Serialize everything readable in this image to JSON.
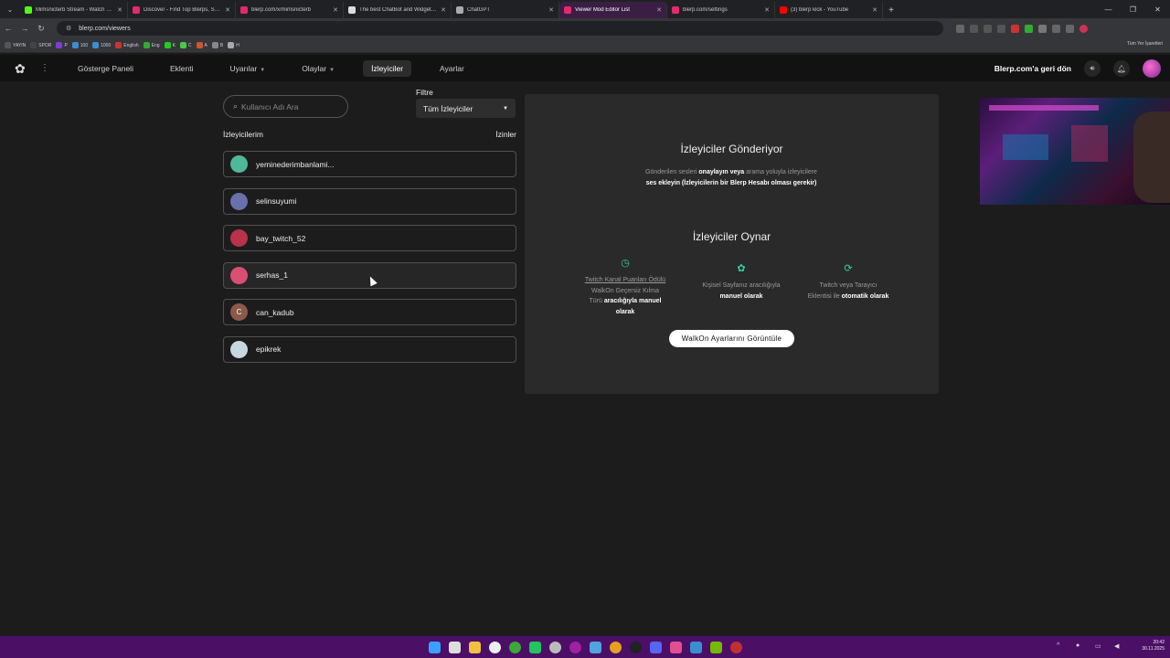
{
  "browser": {
    "tabs": [
      {
        "title": "Mimsnicterb Stream - Watch Li...",
        "color": "#53fc18"
      },
      {
        "title": "Discover - Find Top Blerps, Stre...",
        "color": "#e5296a"
      },
      {
        "title": "blerp.com/x/mimsnicterb",
        "color": "#e5296a"
      },
      {
        "title": "The best ChatBot and Widgets...",
        "color": "#dddddd"
      },
      {
        "title": "ChatGPT",
        "color": "#aaaaaa"
      },
      {
        "title": "Viewer Mod Editor List",
        "color": "#e5296a",
        "active": true
      },
      {
        "title": "blerp.com/settings",
        "color": "#e5296a"
      },
      {
        "title": "(3) blerp kick - YouTube",
        "color": "#ff0000"
      }
    ],
    "url": "blerp.com/viewers",
    "bookmarks": [
      "YAYIN",
      "SPOR",
      "P",
      "100",
      "1000",
      "English",
      "Eng",
      "K",
      "C",
      "A",
      "B",
      "H"
    ],
    "bookmarks_right": "Tüm Yer İşaretleri"
  },
  "nav": {
    "items": [
      {
        "label": "Gösterge Paneli",
        "caret": false
      },
      {
        "label": "Eklenti",
        "caret": false
      },
      {
        "label": "Uyarılar",
        "caret": true
      },
      {
        "label": "Olaylar",
        "caret": true
      },
      {
        "label": "İzleyiciler",
        "caret": false,
        "selected": true
      },
      {
        "label": "Ayarlar",
        "caret": false
      }
    ],
    "back_link": "Blerp.com'a geri dön"
  },
  "search": {
    "placeholder": "Kullanıcı Adı Ara"
  },
  "filter": {
    "label": "Filtre",
    "value": "Tüm İzleyiciler"
  },
  "list": {
    "heading": "İzleyicilerim",
    "permissions": "İzinler",
    "viewers": [
      {
        "name": "yeminederimbanlami...",
        "avatar_color": "#4fb89a",
        "initial": ""
      },
      {
        "name": "selinsuyumi",
        "avatar_color": "#6a6fae",
        "initial": ""
      },
      {
        "name": "bay_twitch_52",
        "avatar_color": "#b8324a",
        "initial": ""
      },
      {
        "name": "serhas_1",
        "avatar_color": "#d94f72",
        "initial": ""
      },
      {
        "name": "can_kadub",
        "avatar_color": "#8b5a4a",
        "initial": "C"
      },
      {
        "name": "epikrek",
        "avatar_color": "#c8d6e0",
        "initial": ""
      }
    ]
  },
  "panel": {
    "send_title": "İzleyiciler Gönderiyor",
    "send_text_1": "Gönderilen sesleri ",
    "send_text_2": "onaylayın veya",
    "send_text_3": " arama yoluyla izleyicilere ",
    "send_text_4": "ses ekleyin (İzleyicilerin bir Blerp Hesabı olması gerekir)",
    "play_title": "İzleyiciler Oynar",
    "features": [
      {
        "icon": "clock-icon",
        "link": "Twitch Kanal Puanları Ödülü",
        "text": " WalkOn Geçersiz Kılma Türü ",
        "bold": "aracılığıyla manuel olarak"
      },
      {
        "icon": "gear-icon",
        "link": "",
        "text": "Kişisel Sayfanız aracılığıyla ",
        "bold": "manuel olarak"
      },
      {
        "icon": "refresh-icon",
        "link": "",
        "text": "Twitch veya Tarayıcı Eklentisi ile ",
        "bold": "otomatik olarak"
      }
    ],
    "button": "WalkOn Ayarlarını Görüntüle"
  },
  "taskbar": {
    "time": "20:42",
    "date": "30.11.2025"
  },
  "colors": {
    "accent": "#35d3a5",
    "taskbar": "#4b0f66"
  }
}
